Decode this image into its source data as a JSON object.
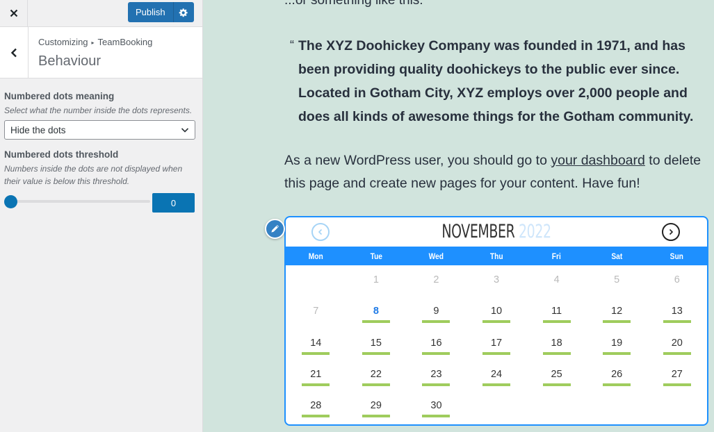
{
  "sidebar": {
    "close_label": "Close",
    "publish_label": "Publish",
    "settings_label": "Publish settings",
    "back_label": "Back",
    "breadcrumb": {
      "root": "Customizing",
      "parent": "TeamBooking"
    },
    "section_title": "Behaviour",
    "controls": {
      "dots_meaning": {
        "label": "Numbered dots meaning",
        "description": "Select what the number inside the dots represents.",
        "selected": "Hide the dots"
      },
      "dots_threshold": {
        "label": "Numbered dots threshold",
        "description": "Numbers inside the dots are not displayed when their value is below this threshold.",
        "value": "0",
        "slider_fraction": 0
      }
    }
  },
  "preview": {
    "intro": "...or something like this:",
    "quote_mark": "“",
    "quote": "The XYZ Doohickey Company was founded in 1971, and has been providing quality doohickeys to the public ever since. Located in Gotham City, XYZ employs over 2,000 people and does all kinds of awesome things for the Gotham community.",
    "para_before": "As a new WordPress user, you should go to ",
    "para_link": "your dashboard",
    "para_after": " to delete this page and create new pages for your content. Have fun!",
    "calendar": {
      "month": "NOVEMBER",
      "year": "2022",
      "weekdays": [
        "Mon",
        "Tue",
        "Wed",
        "Thu",
        "Fri",
        "Sat",
        "Sun"
      ],
      "weeks": [
        [
          {
            "d": ""
          },
          {
            "d": "1",
            "muted": true
          },
          {
            "d": "2",
            "muted": true
          },
          {
            "d": "3",
            "muted": true
          },
          {
            "d": "4",
            "muted": true
          },
          {
            "d": "5",
            "muted": true
          },
          {
            "d": "6",
            "muted": true
          }
        ],
        [
          {
            "d": "7",
            "muted": true
          },
          {
            "d": "8",
            "today": true,
            "avail": true
          },
          {
            "d": "9",
            "avail": true
          },
          {
            "d": "10",
            "avail": true
          },
          {
            "d": "11",
            "avail": true
          },
          {
            "d": "12",
            "avail": true
          },
          {
            "d": "13",
            "avail": true
          }
        ],
        [
          {
            "d": "14",
            "avail": true
          },
          {
            "d": "15",
            "avail": true
          },
          {
            "d": "16",
            "avail": true
          },
          {
            "d": "17",
            "avail": true
          },
          {
            "d": "18",
            "avail": true
          },
          {
            "d": "19",
            "avail": true
          },
          {
            "d": "20",
            "avail": true
          }
        ],
        [
          {
            "d": "21",
            "avail": true
          },
          {
            "d": "22",
            "avail": true
          },
          {
            "d": "23",
            "avail": true
          },
          {
            "d": "24",
            "avail": true
          },
          {
            "d": "25",
            "avail": true
          },
          {
            "d": "26",
            "avail": true
          },
          {
            "d": "27",
            "avail": true
          }
        ],
        [
          {
            "d": "28",
            "avail": true
          },
          {
            "d": "29",
            "avail": true
          },
          {
            "d": "30",
            "avail": true
          },
          {
            "d": ""
          },
          {
            "d": ""
          },
          {
            "d": ""
          },
          {
            "d": ""
          }
        ]
      ]
    }
  },
  "colors": {
    "accent": "#2271b1",
    "calendar_blue": "#1e90ff",
    "availability_green": "#9fcc5d",
    "preview_bg": "#d1e4dd"
  }
}
